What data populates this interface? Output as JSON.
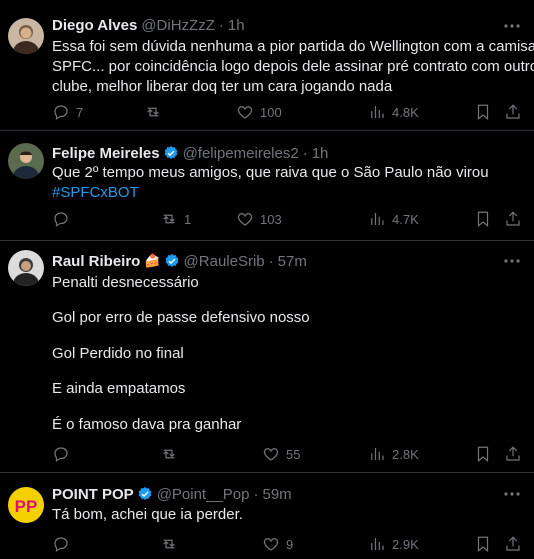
{
  "colors": {
    "background": "#000000",
    "text": "#e7e9ea",
    "muted": "#71767b",
    "link": "#1d9bf0",
    "divider": "#2f3336",
    "verified": "#1d9bf0"
  },
  "tweets": [
    {
      "name": "Diego Alves",
      "handle": "@DiHzZzZ",
      "time": "1h",
      "verified": false,
      "lines": [
        "Essa foi sem dúvida nenhuma a pior partida do Wellington com a camisa do",
        "SPFC... por coincidência logo depois dele assinar pré contrato com outro",
        "clube, melhor liberar doq ter um cara jogando nada"
      ],
      "replies": "7",
      "retweets": "",
      "likes": "100",
      "views": "4.8K"
    },
    {
      "name": "Felipe Meireles",
      "handle": "@felipemeireles2",
      "time": "1h",
      "verified": true,
      "lines": [
        "Que 2º tempo meus amigos, que raiva que o São Paulo não virou"
      ],
      "hashtag": "#SPFCxBOT",
      "replies": "",
      "retweets": "1",
      "likes": "103",
      "views": "4.7K"
    },
    {
      "name": "Raul Ribeiro",
      "emoji": "🍰",
      "handle": "@RauleSrib",
      "time": "57m",
      "verified": true,
      "paragraphs": [
        "Penalti desnecessário",
        "Gol por erro de passe defensivo nosso",
        "Gol Perdido no final",
        "E ainda empatamos",
        "É o famoso dava pra ganhar"
      ],
      "replies": "",
      "retweets": "",
      "likes": "55",
      "views": "2.8K"
    },
    {
      "name": "POINT POP",
      "handle": "@Point__Pop",
      "time": "59m",
      "verified": true,
      "lines": [
        "Tá bom, achei que ia perder."
      ],
      "replies": "",
      "retweets": "",
      "likes": "9",
      "views": "2.9K"
    }
  ],
  "icons": {
    "reply": "reply-icon",
    "retweet": "retweet-icon",
    "like": "heart-icon",
    "views": "views-icon",
    "bookmark": "bookmark-icon",
    "share": "share-icon",
    "more": "more-icon",
    "verified": "verified-badge-icon"
  }
}
